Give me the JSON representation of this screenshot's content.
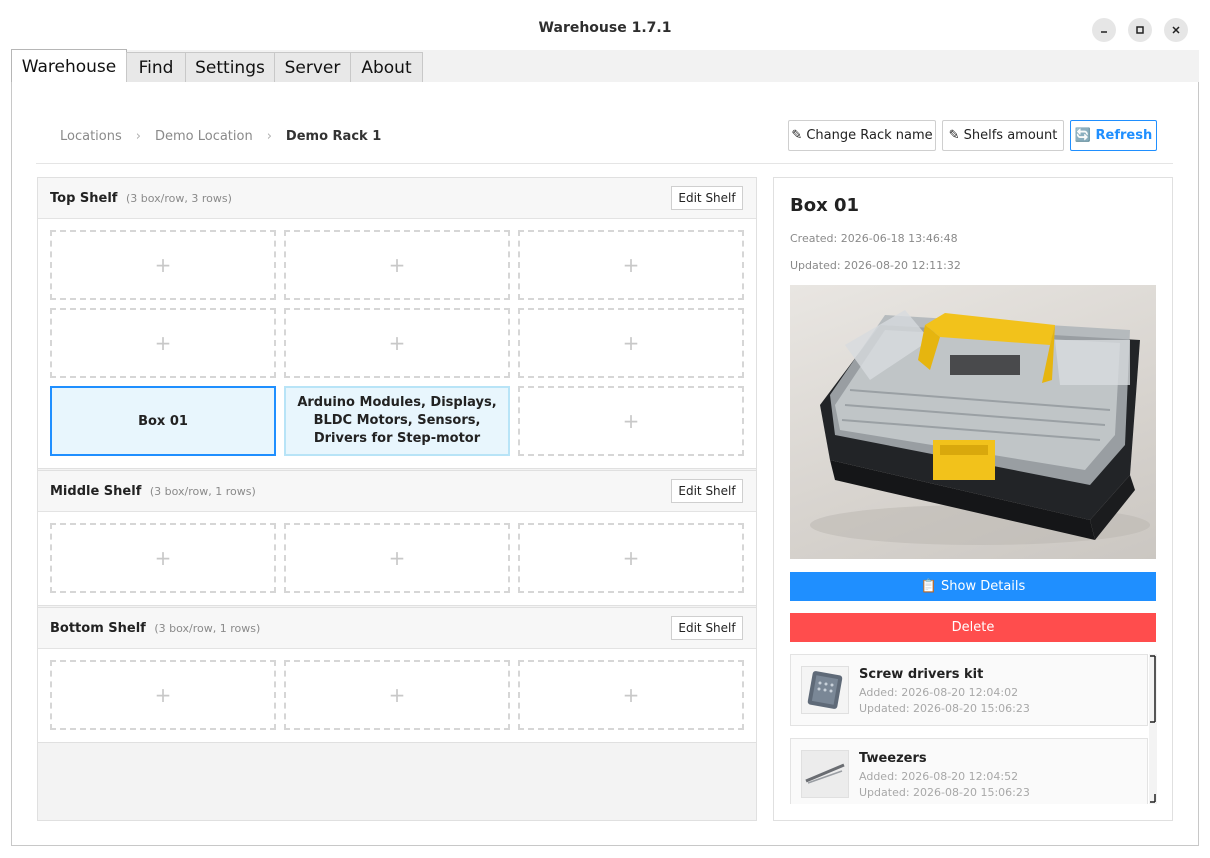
{
  "window": {
    "title": "Warehouse 1.7.1"
  },
  "tabs": [
    {
      "label": "Warehouse"
    },
    {
      "label": "Find"
    },
    {
      "label": "Settings"
    },
    {
      "label": "Server"
    },
    {
      "label": "About"
    }
  ],
  "breadcrumb": {
    "items": [
      "Locations",
      "Demo Location",
      "Demo Rack 1"
    ],
    "separator": "›"
  },
  "toolbar": {
    "change_rack_name": "✎ Change Rack name",
    "shelfs_amount": "✎ Shelfs amount",
    "refresh": "🔄 Refresh"
  },
  "shelves": [
    {
      "name": "Top Shelf",
      "meta": "(3 box/row, 3 rows)",
      "edit_label": "Edit Shelf",
      "slots": [
        "+",
        "+",
        "+",
        "+",
        "+",
        "+",
        "Box 01",
        "Arduino Modules, Displays, BLDC Motors, Sensors, Drivers for Step-motor",
        "+"
      ]
    },
    {
      "name": "Middle Shelf",
      "meta": "(3 box/row, 1 rows)",
      "edit_label": "Edit Shelf",
      "slots": [
        "+",
        "+",
        "+"
      ]
    },
    {
      "name": "Bottom Shelf",
      "meta": "(3 box/row, 1 rows)",
      "edit_label": "Edit Shelf",
      "slots": [
        "+",
        "+",
        "+"
      ]
    }
  ],
  "details": {
    "title": "Box 01",
    "created": "Created: 2026-06-18 13:46:48",
    "updated": "Updated: 2026-08-20 12:11:32",
    "show_details": "📋 Show Details",
    "delete": "Delete",
    "items": [
      {
        "name": "Screw drivers kit",
        "added": "Added: 2026-08-20 12:04:02",
        "updated": "Updated: 2026-08-20 15:06:23"
      },
      {
        "name": "Tweezers",
        "added": "Added: 2026-08-20 12:04:52",
        "updated": "Updated: 2026-08-20 15:06:23"
      }
    ]
  },
  "colors": {
    "accent": "#1f8fff",
    "danger": "#ff4d4d",
    "selected_bg": "#e8f6fd"
  }
}
